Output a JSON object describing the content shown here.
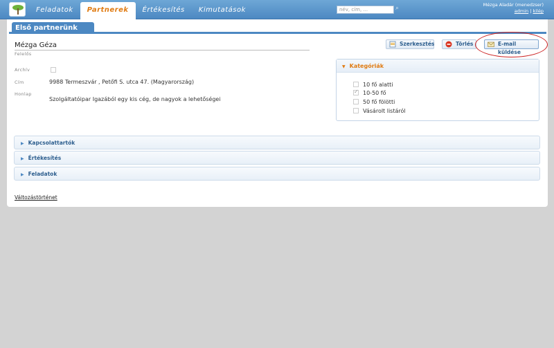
{
  "nav": {
    "tabs": [
      {
        "label": "Feladatok"
      },
      {
        "label": "Partnerek"
      },
      {
        "label": "Értékesítés"
      },
      {
        "label": "Kimutatások"
      }
    ],
    "active_tab": "Partnerek",
    "search_placeholder": "név, cím, ...",
    "user_line": "Mézga Aladár (menedzser)",
    "admin_link": "admin",
    "separator": "|",
    "logout_link": "kilép"
  },
  "page": {
    "title": "Első partnerünk"
  },
  "contact": {
    "name": "Mézga Géza",
    "responsible_label": "Felelős"
  },
  "fields": {
    "archive_label": "Archív",
    "address_label": "Cím",
    "address_value": "9988 Termeszvár , Petőfi S. utca 47. (Magyarország)",
    "homepage_label": "Honlap",
    "description": "Szolgáltatóipar Igazából egy kis cég, de nagyok a lehetőségei"
  },
  "actions": {
    "edit": "Szerkesztés",
    "delete": "Törlés",
    "email": "E-mail küldése"
  },
  "categories": {
    "title": "Kategóriák",
    "items": [
      {
        "label": "10 fő alatti",
        "checked": false
      },
      {
        "label": "10-50 fő",
        "checked": true
      },
      {
        "label": "50 fő fölötti",
        "checked": false
      },
      {
        "label": "Vásárolt listáról",
        "checked": false
      }
    ]
  },
  "sections": [
    {
      "label": "Kapcsolattartók"
    },
    {
      "label": "Értékesítés"
    },
    {
      "label": "Feladatok"
    }
  ],
  "footer": {
    "history_link": "Változástörténet"
  },
  "colors": {
    "primary": "#4c88c2",
    "accent": "#e07b12",
    "highlight": "#cc2222"
  }
}
